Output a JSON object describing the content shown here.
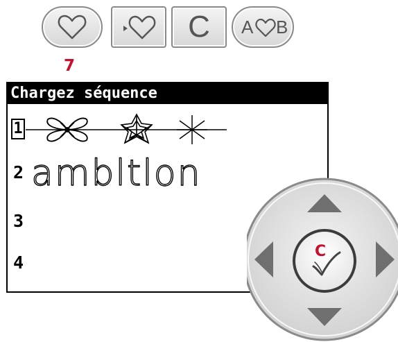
{
  "toolbar": {
    "buttons": [
      {
        "name": "favorite",
        "icon": "heart-icon"
      },
      {
        "name": "load-sequence",
        "icon": "load-heart-icon"
      },
      {
        "name": "clear",
        "icon": "letter-c",
        "label": "C"
      },
      {
        "name": "text-edit",
        "icon": "letter-heart-icon",
        "label_left": "A",
        "label_right": "B"
      }
    ],
    "callout": "7"
  },
  "panel": {
    "title": "Chargez séquence",
    "rows": [
      {
        "number": "1",
        "content": "stitch-pattern",
        "selected": true
      },
      {
        "number": "2",
        "content": "ambltlon"
      },
      {
        "number": "3",
        "content": ""
      },
      {
        "number": "4",
        "content": ""
      }
    ]
  },
  "dpad": {
    "callout": "C",
    "center_icon": "checkmark-icon",
    "arrows": [
      "up",
      "down",
      "left",
      "right"
    ]
  },
  "colors": {
    "callout": "#c8102e",
    "button_border": "#8a8a8a",
    "icon_gray": "#555555",
    "pad_gray": "#d9d9d9",
    "arrow_gray": "#6f6f6f"
  }
}
